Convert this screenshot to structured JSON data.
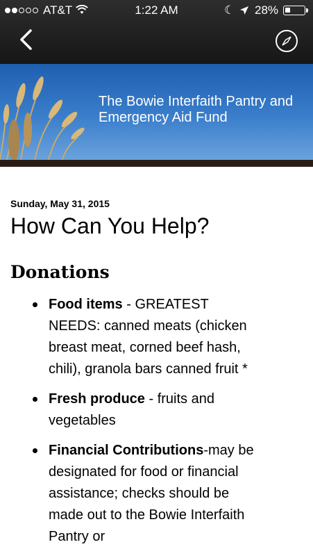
{
  "status_bar": {
    "carrier": "AT&T",
    "time": "1:22 AM",
    "battery_pct": "28%",
    "battery_level": 0.28,
    "signal_bars_on": 2,
    "signal_bars_total": 5,
    "icons": [
      "wifi-icon",
      "moon-icon",
      "location-arrow-icon",
      "battery-icon"
    ]
  },
  "nav": {
    "back_icon": "chevron-left-icon",
    "compass_icon": "compass-icon"
  },
  "banner": {
    "title": "The Bowie Interfaith Pantry and\nEmergency Aid Fund",
    "colors": {
      "top": "#1f5fb0",
      "bottom": "#6aa2dc",
      "stripe": "#2a1c14"
    }
  },
  "post": {
    "date": "Sunday, May 31, 2015",
    "title": "How Can You Help?",
    "section_heading": "Donations",
    "items": [
      {
        "bold": "Food items",
        "text": " - GREATEST NEEDS:   canned meats (chicken breast meat,  corned beef hash, chili), granola bars canned fruit *"
      },
      {
        "bold": "Fresh produce",
        "text": " - fruits and vegetables"
      },
      {
        "bold": "Financial Contributions",
        "text": "-may be designated for food or financial assistance; checks should be made out to the Bowie Interfaith Pantry or"
      }
    ]
  }
}
